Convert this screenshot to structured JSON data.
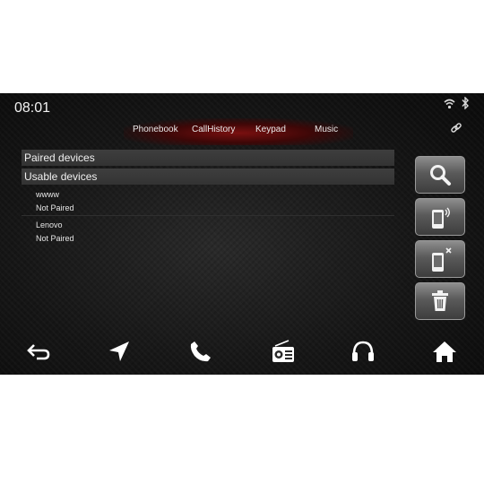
{
  "status": {
    "time": "08:01",
    "icons": [
      "wifi-icon",
      "bluetooth-icon",
      "link-icon"
    ]
  },
  "tabs": [
    {
      "label": "Phonebook"
    },
    {
      "label": "CallHistory"
    },
    {
      "label": "Keypad"
    },
    {
      "label": "Music"
    }
  ],
  "sections": {
    "paired": "Paired devices",
    "usable": "Usable devices"
  },
  "devices": [
    {
      "name": "wwww",
      "status": "Not Paired"
    },
    {
      "name": "Lenovo",
      "status": "Not Paired"
    }
  ],
  "side_buttons": [
    "search-icon",
    "phone-connect-icon",
    "phone-disconnect-icon",
    "trash-icon"
  ],
  "dock": [
    "back-icon",
    "navigation-icon",
    "phone-icon",
    "radio-icon",
    "headphones-icon",
    "home-icon"
  ],
  "colors": {
    "accent": "#7a1010",
    "background": "#141414",
    "text": "#f0f0f0"
  }
}
